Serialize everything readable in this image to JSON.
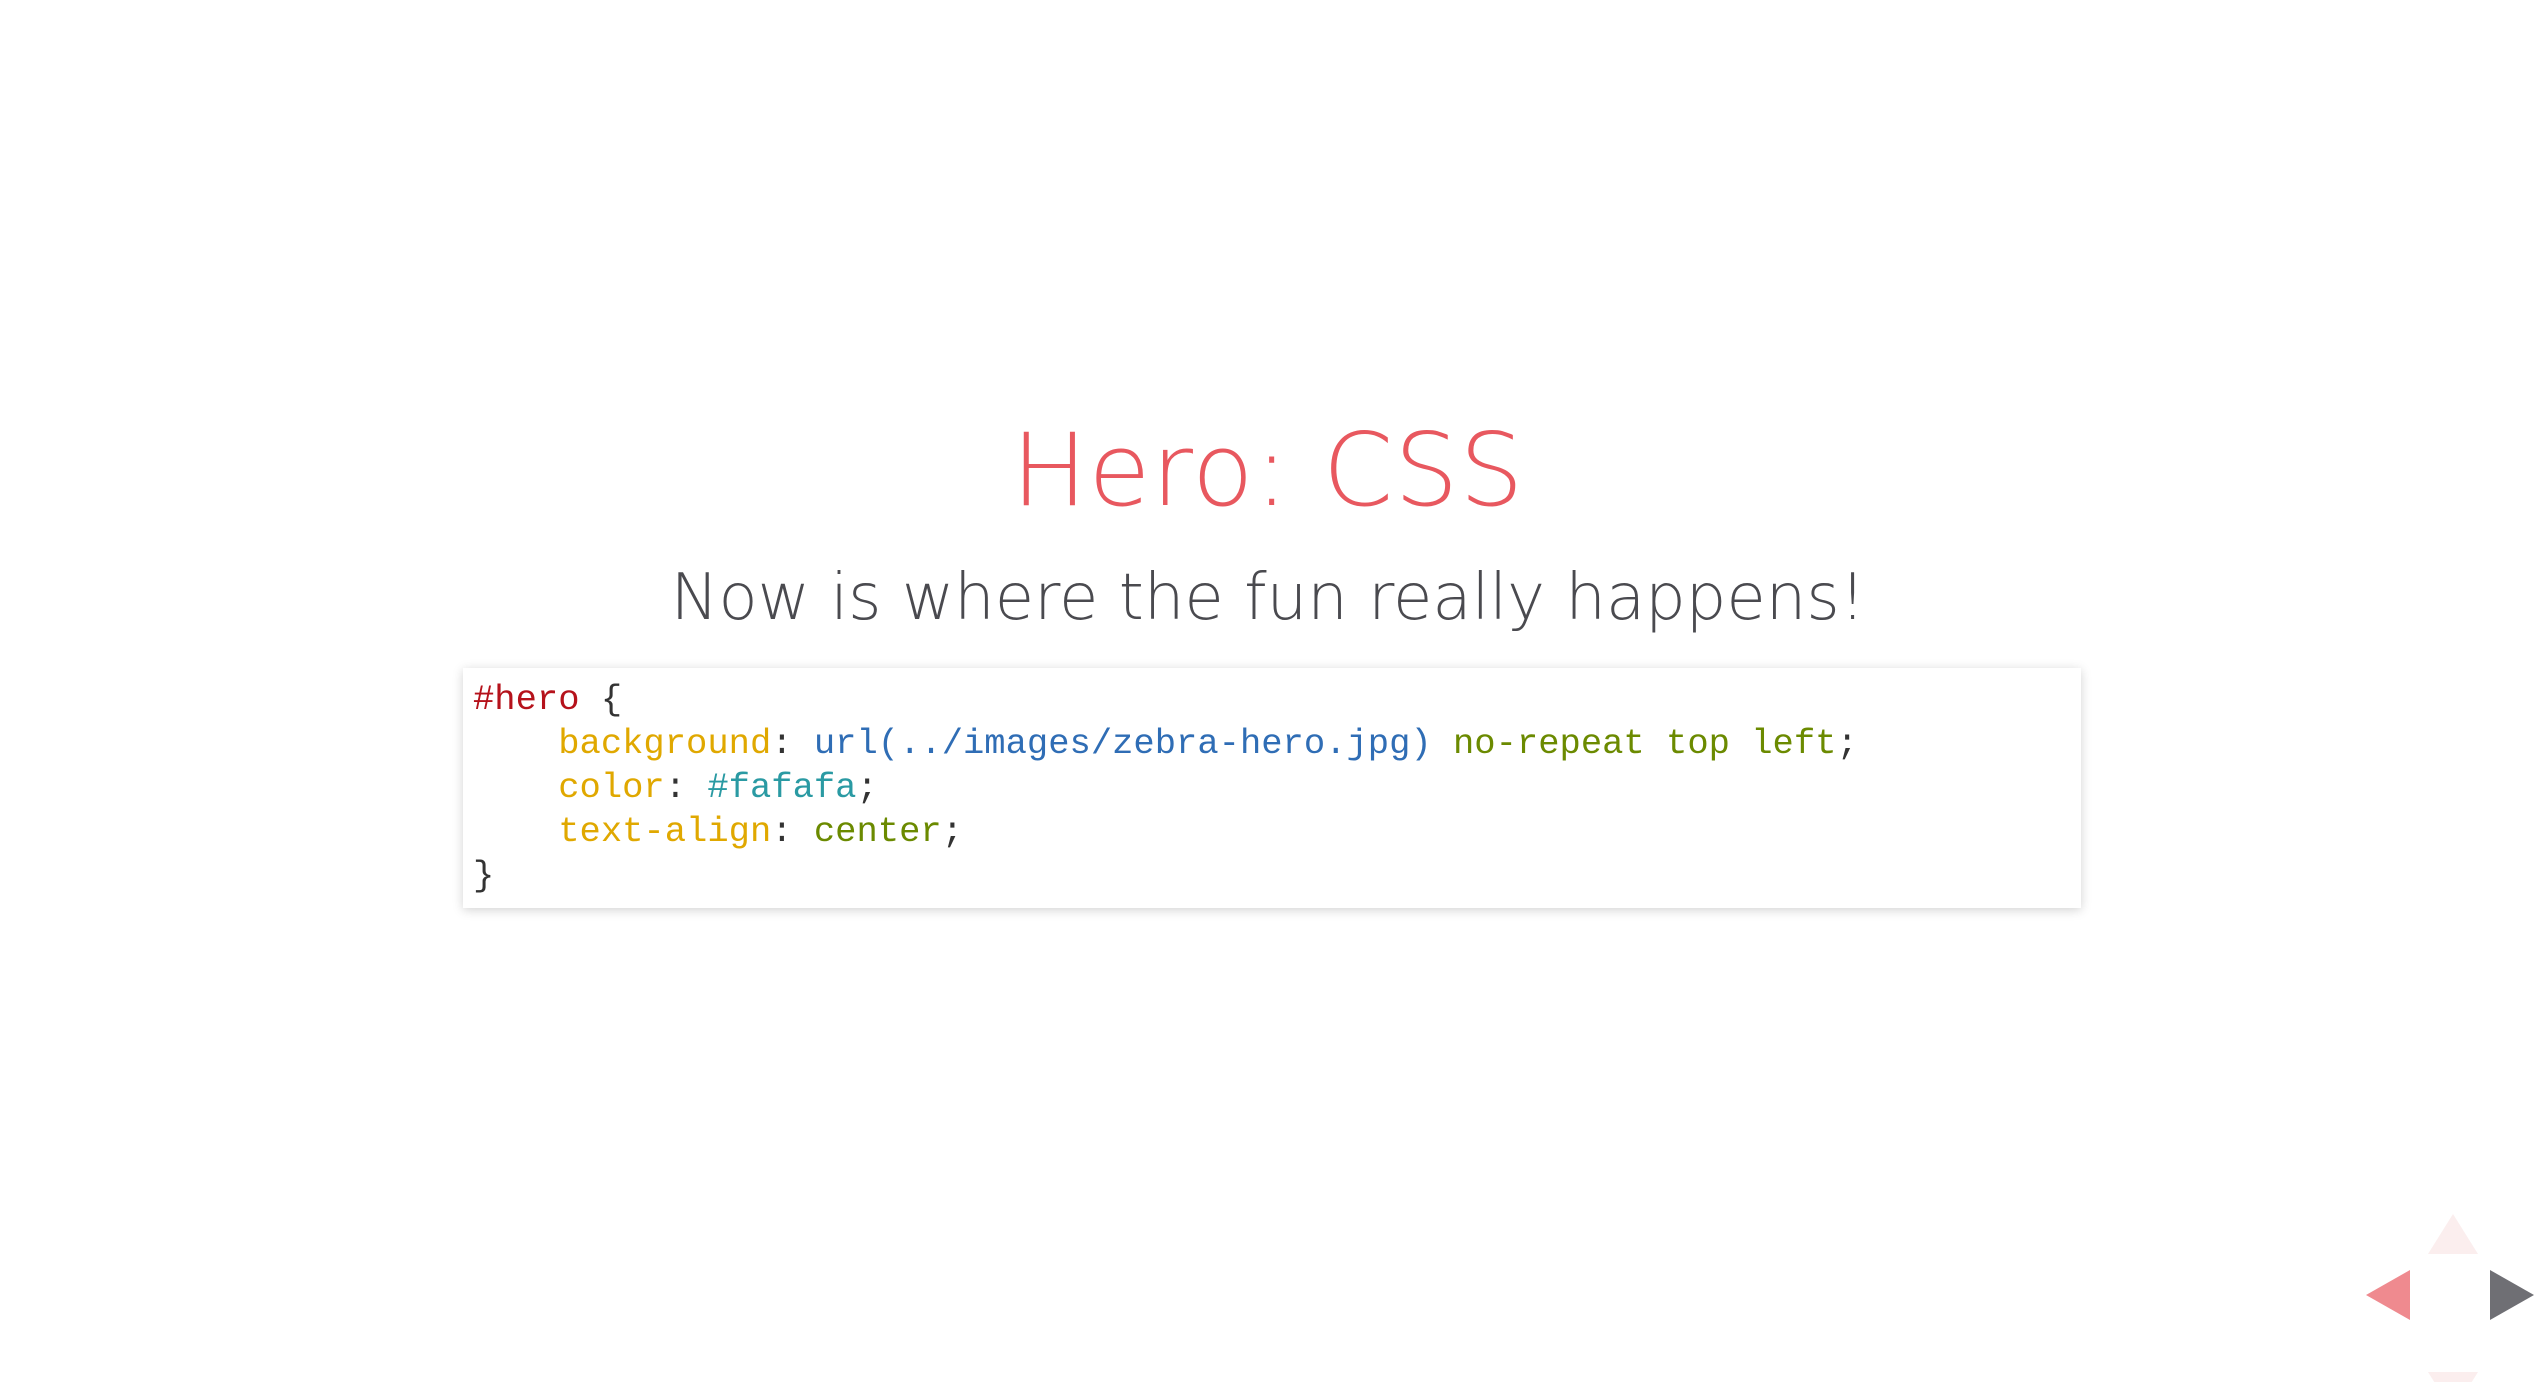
{
  "slide": {
    "title": "Hero: CSS",
    "subtitle": "Now is where the fun really happens!"
  },
  "code": {
    "selector": "#hero",
    "open_brace": " {",
    "close_brace": "}",
    "indent": "    ",
    "lines": [
      {
        "property": "background",
        "colon": ": ",
        "value_url": "url(../images/zebra-hero.jpg)",
        "space": " ",
        "value_rest": "no-repeat top left",
        "semicolon": ";"
      },
      {
        "property": "color",
        "colon": ": ",
        "value_hex": "#fafafa",
        "semicolon": ";"
      },
      {
        "property": "text-align",
        "colon": ": ",
        "value_kw": "center",
        "semicolon": ";"
      }
    ]
  },
  "colors": {
    "title": "#e8585f",
    "subtitle": "#4a4a4f",
    "selector": "#b5121b",
    "property": "#e0a800",
    "url": "#2f6db5",
    "keyword": "#6b8a00",
    "hex": "#2a9aa3"
  },
  "nav": {
    "left_icon": "triangle-left-icon",
    "right_icon": "triangle-right-icon",
    "up_icon": "triangle-up-icon",
    "down_icon": "triangle-down-icon"
  }
}
